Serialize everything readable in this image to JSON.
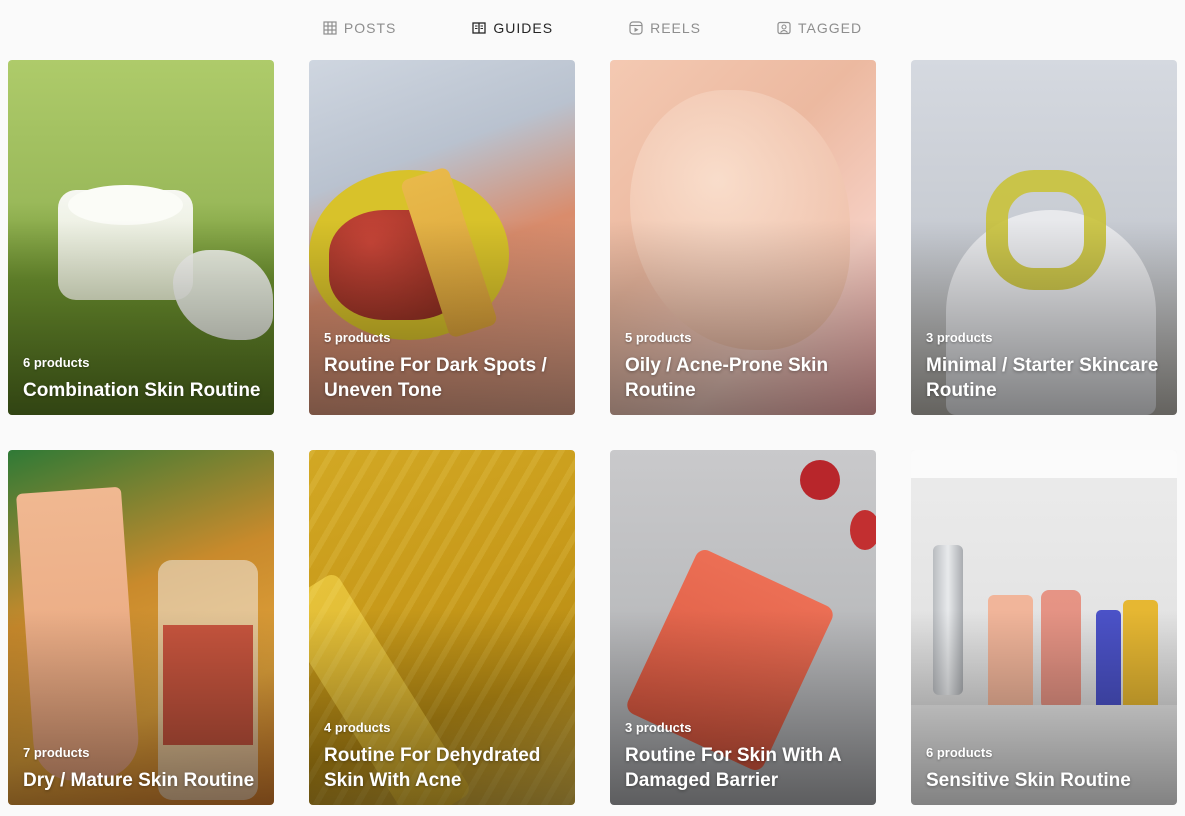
{
  "tabs": [
    {
      "label": "POSTS",
      "icon": "grid-icon",
      "active": false
    },
    {
      "label": "GUIDES",
      "icon": "book-icon",
      "active": true
    },
    {
      "label": "REELS",
      "icon": "reels-icon",
      "active": false
    },
    {
      "label": "TAGGED",
      "icon": "tag-user-icon",
      "active": false
    }
  ],
  "guides": [
    {
      "count": "6 products",
      "title": "Combination Skin Routine"
    },
    {
      "count": "5 products",
      "title": "Routine For Dark Spots / Uneven Tone"
    },
    {
      "count": "5 products",
      "title": "Oily / Acne-Prone Skin Routine"
    },
    {
      "count": "3 products",
      "title": "Minimal / Starter Skincare Routine"
    },
    {
      "count": "7 products",
      "title": "Dry / Mature Skin Routine"
    },
    {
      "count": "4 products",
      "title": "Routine For Dehydrated Skin With Acne"
    },
    {
      "count": "3 products",
      "title": "Routine For Skin With A Damaged Barrier"
    },
    {
      "count": "6 products",
      "title": "Sensitive Skin Routine"
    }
  ]
}
